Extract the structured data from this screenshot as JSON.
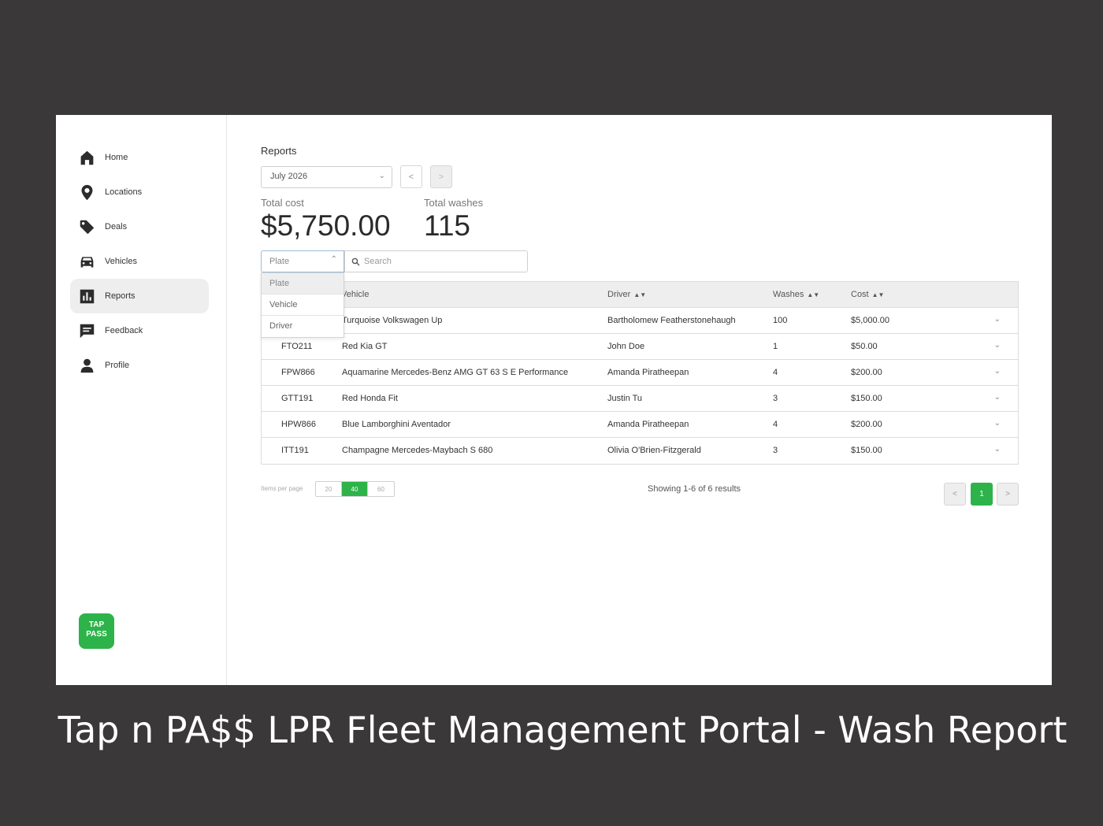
{
  "sidebar": {
    "items": [
      {
        "label": "Home",
        "icon": "home-icon"
      },
      {
        "label": "Locations",
        "icon": "location-pin-icon"
      },
      {
        "label": "Deals",
        "icon": "tag-icon"
      },
      {
        "label": "Vehicles",
        "icon": "car-icon"
      },
      {
        "label": "Reports",
        "icon": "bar-chart-icon",
        "active": true
      },
      {
        "label": "Feedback",
        "icon": "message-icon"
      },
      {
        "label": "Profile",
        "icon": "user-icon"
      }
    ],
    "logo": {
      "line1": "TAP",
      "line2": "PASS",
      "color": "#2db34a"
    }
  },
  "reports": {
    "title": "Reports",
    "month": "July 2026",
    "prev_label": "<",
    "next_label": ">",
    "total_cost_label": "Total cost",
    "total_cost": "$5,750.00",
    "total_washes_label": "Total washes",
    "total_washes": "115"
  },
  "filter": {
    "selected": "Plate",
    "options": [
      "Plate",
      "Vehicle",
      "Driver"
    ],
    "search_placeholder": "Search"
  },
  "table": {
    "headers": {
      "vehicle": "Vehicle",
      "driver": "Driver",
      "washes": "Washes",
      "cost": "Cost"
    },
    "rows": [
      {
        "plate": "",
        "vehicle": "Turquoise Volkswagen Up",
        "driver": "Bartholomew Featherstonehaugh",
        "washes": "100",
        "cost": "$5,000.00"
      },
      {
        "plate": "FTO211",
        "vehicle": "Red Kia GT",
        "driver": "John Doe",
        "washes": "1",
        "cost": "$50.00"
      },
      {
        "plate": "FPW866",
        "vehicle": "Aquamarine Mercedes-Benz AMG GT 63 S E Performance",
        "driver": "Amanda Piratheepan",
        "washes": "4",
        "cost": "$200.00"
      },
      {
        "plate": "GTT191",
        "vehicle": "Red Honda Fit",
        "driver": "Justin Tu",
        "washes": "3",
        "cost": "$150.00"
      },
      {
        "plate": "HPW866",
        "vehicle": "Blue Lamborghini Aventador",
        "driver": "Amanda Piratheepan",
        "washes": "4",
        "cost": "$200.00"
      },
      {
        "plate": "ITT191",
        "vehicle": "Champagne Mercedes-Maybach S 680",
        "driver": "Olivia O'Brien-Fitzgerald",
        "washes": "3",
        "cost": "$150.00"
      }
    ]
  },
  "pagination": {
    "items_per_page_label": "Items per page",
    "options": [
      "20",
      "40",
      "60"
    ],
    "active_option": "40",
    "showing": "Showing 1-6 of 6 results",
    "current_page": "1",
    "prev_label": "<",
    "next_label": ">"
  },
  "caption": "Tap n PA$$ LPR Fleet Management Portal - Wash Report",
  "colors": {
    "accent": "#2db34a",
    "frame": "#3a3838"
  }
}
